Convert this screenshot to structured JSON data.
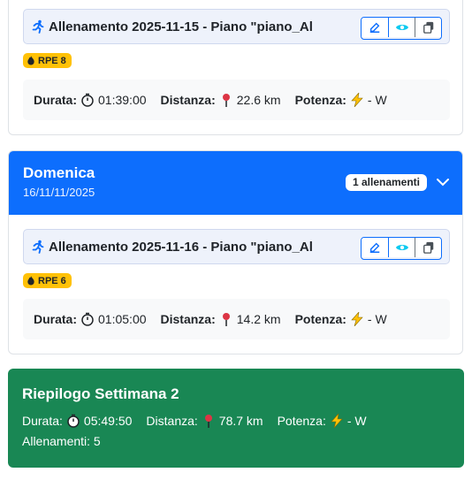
{
  "sessions": [
    {
      "title": "Allenamento 2025-11-15 - Piano \"piano_Al",
      "rpe": "RPE 8",
      "duration_label": "Durata:",
      "duration": "01:39:00",
      "distance_label": "Distanza:",
      "distance": "22.6 km",
      "power_label": "Potenza:",
      "power": "- W"
    },
    {
      "title": "Allenamento 2025-11-16 - Piano \"piano_Al",
      "rpe": "RPE 6",
      "duration_label": "Durata:",
      "duration": "01:05:00",
      "distance_label": "Distanza:",
      "distance": "14.2 km",
      "power_label": "Potenza:",
      "power": "- W"
    }
  ],
  "day": {
    "title": "Domenica",
    "date": "16/11/11/2025",
    "count_badge": "1 allenamenti"
  },
  "summary": {
    "title": "Riepilogo Settimana 2",
    "duration_label": "Durata:",
    "duration": "05:49:50",
    "distance_label": "Distanza:",
    "distance": "78.7 km",
    "power_label": "Potenza:",
    "power": "- W",
    "workouts": "Allenamenti: 5"
  },
  "icons": {
    "run": "running-icon",
    "edit": "edit-icon",
    "view": "eye-icon",
    "copy": "copy-icon",
    "fire": "fire-icon",
    "timer": "stopwatch-icon",
    "pin": "pin-icon",
    "bolt": "lightning-icon",
    "chevron": "chevron-down-icon"
  },
  "colors": {
    "primary": "#0d6efd",
    "success": "#198754",
    "warning": "#ffc107"
  }
}
